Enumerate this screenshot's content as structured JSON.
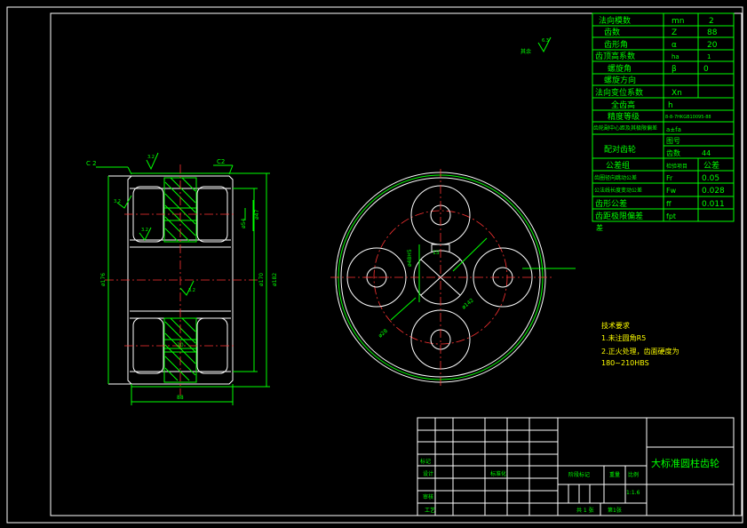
{
  "colors": {
    "background": "#000000",
    "outline": "#ffffff",
    "table": "#00ff00",
    "centerline": "#ff3333",
    "notes": "#ffff00"
  },
  "params": [
    {
      "label": "法向模数",
      "sym": "mn",
      "val": "2"
    },
    {
      "label": "齿数",
      "sym": "Z",
      "val": "88"
    },
    {
      "label": "齿形角",
      "sym": "α",
      "val": "20"
    },
    {
      "label": "齿顶高系数",
      "sym": "ha",
      "val": "1"
    },
    {
      "label": "螺旋角",
      "sym": "β",
      "val": "0"
    },
    {
      "label": "螺旋方向",
      "sym": "",
      "val": ""
    },
    {
      "label": "法向变位系数",
      "sym": "Xn",
      "val": ""
    },
    {
      "label": "全齿高",
      "sym": "h",
      "val": ""
    },
    {
      "label": "精度等级",
      "sym": "",
      "val": "8-8-7HKGB10095-88"
    },
    {
      "label": "齿轮副中心距及其极限偏差",
      "sym": "a±fa",
      "val": ""
    }
  ],
  "mating": {
    "label": "配对齿轮",
    "row1_sym": "图号",
    "row1_val": "",
    "row2_sym": "齿数",
    "row2_val": "44"
  },
  "check": {
    "label": "公差组",
    "col_item": "检验项目",
    "col_tol": "公差"
  },
  "tolerances": [
    {
      "label": "齿圈径向跳动公差",
      "sym": "Fr",
      "val": "0.05"
    },
    {
      "label": "公法线长度变动公差",
      "sym": "Fw",
      "val": "0.028"
    },
    {
      "label": "齿形公差",
      "sym": "ff",
      "val": "0.011"
    },
    {
      "label": "齿距极限偏差",
      "sym": "fpt",
      "val": ""
    }
  ],
  "tol_extra": "差",
  "side_view": {
    "chamfer_left": "C 2",
    "chamfer_right": "C2",
    "rough_top": "3.2",
    "rough_left": "3.2",
    "rough_hub": "3.2",
    "rough_mid": "3.2",
    "dim_hub_inner": "ø54",
    "dim_hub_outer": "ø47",
    "dim_left_dia": "ø176",
    "dim_bore": "ø170",
    "dim_outer": "ø182",
    "dim_inner_width": "20",
    "dim_width": "88"
  },
  "front_view": {
    "dim_keyway": "ø48H5",
    "dim_key": "15",
    "dim_circle": "ø142",
    "dim_hole": "ø28"
  },
  "rough_note": {
    "label": "其余",
    "val": "6.3"
  },
  "notes": {
    "title": "技术要求",
    "line1": "1.未注圆角R5",
    "line2": "2.正火处理，齿面硬度为",
    "line3": "180~210HBS"
  },
  "title_block": {
    "part_name": "大标准圆柱齿轮",
    "mark": "标记",
    "design": "设计",
    "std": "标准化",
    "review": "审核",
    "process": "工艺",
    "stage": "阶段标记",
    "weight": "重量",
    "scale_label": "比例",
    "scale": "1:1.6",
    "sheet_total": "共 1 张",
    "sheet_no": "第1张"
  }
}
